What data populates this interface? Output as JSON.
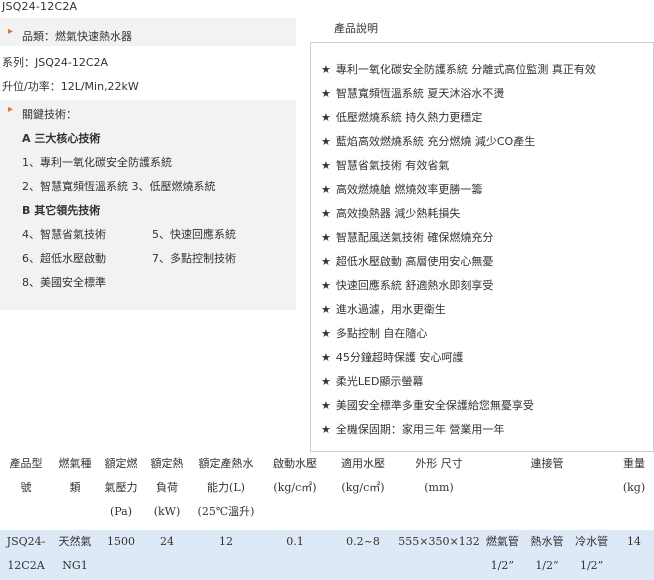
{
  "model_title": "JSQ24-12C2A",
  "left": {
    "category": "品類：燃氣快速熱水器",
    "series": "系列：JSQ24-12C2A",
    "capacity": "升位/功率：12L/Min,22kW",
    "key_tech_label": "關鍵技術：",
    "section_a": "A 三大核心技術",
    "item_1": "1、專利一氧化碳安全防護系統",
    "item_2_3": "2、智慧寬頻恆溫系統 3、低壓燃燒系統",
    "section_b": "B 其它領先技術",
    "item_4": "4、智慧省氣技術",
    "item_5": "5、快速回應系統",
    "item_6": "6、超低水壓啟動",
    "item_7": "7、多點控制技術",
    "item_8": "8、美國安全標準"
  },
  "right": {
    "heading": "產品說明",
    "star_glyph": "★",
    "features": [
      "專利一氧化碳安全防護系統  分離式高位監測 真正有效",
      "智慧寬頻恆溫系統 夏天沐浴水不燙",
      "低壓燃燒系統  持久熱力更穩定",
      "藍焰高效燃燒系統 充分燃燒 減少CO產生",
      "智慧省氣技術 有效省氣",
      "高效燃燒艙 燃燒效率更勝一籌",
      "高效換熱器 減少熱耗損失",
      "智慧配風送氣技術 確保燃燒充分",
      "超低水壓啟動 高層使用安心無憂",
      "快速回應系統 舒適熱水即刻享受",
      "進水過濾，用水更衛生",
      "多點控制 自在隨心",
      "45分鐘超時保護 安心呵護",
      "柔光LED顯示螢幕",
      "美國安全標準多重安全保護給您無憂享受",
      "全機保固期：家用三年 營業用一年"
    ]
  },
  "spec_table": {
    "headers": [
      [
        "產品型",
        "號"
      ],
      [
        "燃氣種",
        "類"
      ],
      [
        "額定燃",
        "氣壓力",
        "(Pa)"
      ],
      [
        "額定熱",
        "負荷",
        "(kW)"
      ],
      [
        "額定產熱水",
        "能力(L)",
        "(25℃溫升)"
      ],
      [
        "啟動水壓",
        "(kg/c㎡)"
      ],
      [
        "適用水壓",
        "(kg/c㎡)"
      ],
      [
        "外形 尺寸",
        "(mm)"
      ],
      [
        "連接管"
      ],
      [
        "重量",
        "(kg)"
      ]
    ],
    "row": {
      "model": [
        "JSQ24-",
        "12C2A"
      ],
      "gas": [
        "天然氣",
        "NG1"
      ],
      "pressure": "1500",
      "heat_load": "24",
      "hot_water": "12",
      "start_pressure": "0.1",
      "applicable_pressure": "0.2~8",
      "dimensions": "555×350×132",
      "connections": [
        [
          "燃氣管",
          "1/2”"
        ],
        [
          "熱水管",
          "1/2”"
        ],
        [
          "冷水管",
          "1/2”"
        ]
      ],
      "weight": "14"
    }
  }
}
